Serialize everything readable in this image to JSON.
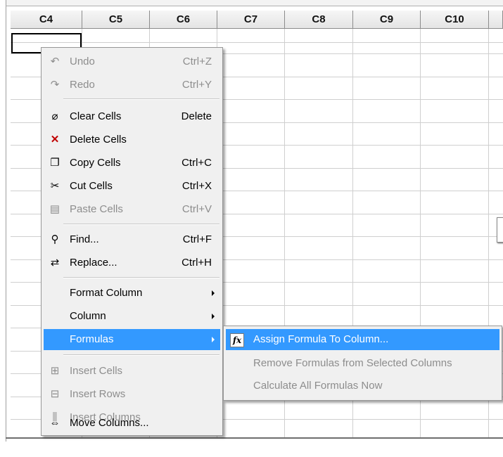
{
  "columns": [
    "C4",
    "C5",
    "C6",
    "C7",
    "C8",
    "C9",
    "C10"
  ],
  "context_menu": {
    "items": [
      {
        "name": "undo",
        "label": "Undo",
        "shortcut": "Ctrl+Z",
        "icon": "undo-icon",
        "glyph": "↶",
        "disabled": true
      },
      {
        "name": "redo",
        "label": "Redo",
        "shortcut": "Ctrl+Y",
        "icon": "redo-icon",
        "glyph": "↷",
        "disabled": true
      },
      {
        "name": "clear-cells",
        "label": "Clear Cells",
        "shortcut": "Delete",
        "icon": "eraser-icon",
        "glyph": "⌀",
        "disabled": false
      },
      {
        "name": "delete-cells",
        "label": "Delete Cells",
        "shortcut": "",
        "icon": "delete-x-icon",
        "glyph": "✕",
        "disabled": false
      },
      {
        "name": "copy-cells",
        "label": "Copy Cells",
        "shortcut": "Ctrl+C",
        "icon": "copy-icon",
        "glyph": "❐",
        "disabled": false
      },
      {
        "name": "cut-cells",
        "label": "Cut Cells",
        "shortcut": "Ctrl+X",
        "icon": "scissors-icon",
        "glyph": "✂",
        "disabled": false
      },
      {
        "name": "paste-cells",
        "label": "Paste Cells",
        "shortcut": "Ctrl+V",
        "icon": "paste-icon",
        "glyph": "▤",
        "disabled": true
      },
      {
        "name": "find",
        "label": "Find...",
        "shortcut": "Ctrl+F",
        "icon": "binoculars-icon",
        "glyph": "⚲",
        "disabled": false
      },
      {
        "name": "replace",
        "label": "Replace...",
        "shortcut": "Ctrl+H",
        "icon": "replace-icon",
        "glyph": "⇄",
        "disabled": false
      },
      {
        "name": "format-column",
        "label": "Format Column",
        "shortcut": "",
        "icon": "",
        "glyph": "",
        "disabled": false,
        "submenu": true
      },
      {
        "name": "column",
        "label": "Column",
        "shortcut": "",
        "icon": "",
        "glyph": "",
        "disabled": false,
        "submenu": true
      },
      {
        "name": "formulas",
        "label": "Formulas",
        "shortcut": "",
        "icon": "",
        "glyph": "",
        "disabled": false,
        "submenu": true,
        "highlighted": true
      },
      {
        "name": "insert-cells",
        "label": "Insert Cells",
        "shortcut": "",
        "icon": "insert-cells-icon",
        "glyph": "⊞",
        "disabled": true
      },
      {
        "name": "insert-rows",
        "label": "Insert Rows",
        "shortcut": "",
        "icon": "insert-rows-icon",
        "glyph": "⊟",
        "disabled": true
      },
      {
        "name": "insert-columns",
        "label": "Insert Columns",
        "shortcut": "",
        "icon": "insert-columns-icon",
        "glyph": "⫼",
        "disabled": true
      },
      {
        "name": "move-columns",
        "label": "Move Columns...",
        "shortcut": "",
        "icon": "move-columns-icon",
        "glyph": "⇔",
        "disabled": false
      }
    ]
  },
  "formulas_submenu": {
    "items": [
      {
        "name": "assign-formula",
        "label": "Assign Formula To Column...",
        "icon": "fx-icon",
        "glyph": "fx",
        "disabled": false,
        "highlighted": true
      },
      {
        "name": "remove-formulas",
        "label": "Remove Formulas from Selected Columns",
        "icon": "",
        "glyph": "",
        "disabled": true
      },
      {
        "name": "calculate-formulas",
        "label": "Calculate All Formulas Now",
        "icon": "",
        "glyph": "",
        "disabled": true
      }
    ]
  }
}
